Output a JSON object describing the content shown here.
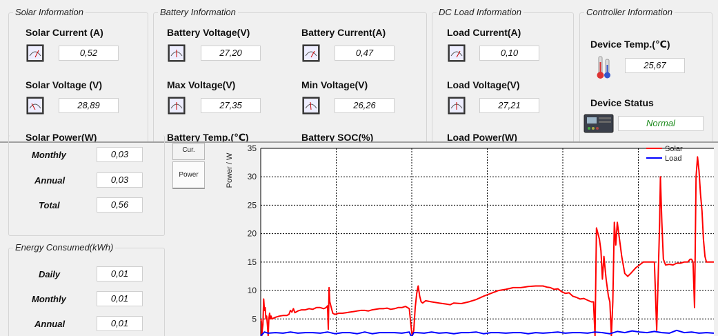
{
  "solar": {
    "title": "Solar Information",
    "current_label": "Solar Current (A)",
    "current_value": "0,52",
    "voltage_label": "Solar Voltage (V)",
    "voltage_value": "28,89",
    "power_label": "Solar Power(W)"
  },
  "battery": {
    "title": "Battery Information",
    "voltage_label": "Battery Voltage(V)",
    "voltage_value": "27,20",
    "current_label": "Battery Current(A)",
    "current_value": "0,47",
    "max_label": "Max Voltage(V)",
    "max_value": "27,35",
    "min_label": "Min Voltage(V)",
    "min_value": "26,26",
    "temp_label": "Battery Temp.(℃)",
    "soc_label": "Battery SOC(%)"
  },
  "load": {
    "title": "DC Load Information",
    "current_label": "Load Current(A)",
    "current_value": "0,10",
    "voltage_label": "Load Voltage(V)",
    "voltage_value": "27,21",
    "power_label": "Load Power(W)"
  },
  "controller": {
    "title": "Controller Information",
    "temp_label": "Device Temp.(℃)",
    "temp_value": "25,67",
    "status_label": "Device Status",
    "status_value": "Normal"
  },
  "generated": {
    "monthly_label": "Monthly",
    "monthly_value": "0,03",
    "annual_label": "Annual",
    "annual_value": "0,03",
    "total_label": "Total",
    "total_value": "0,56"
  },
  "consumed": {
    "title": "Energy Consumed(kWh)",
    "daily_label": "Daily",
    "daily_value": "0,01",
    "monthly_label": "Monthly",
    "monthly_value": "0,01",
    "annual_label": "Annual",
    "annual_value": "0,01"
  },
  "tabs": {
    "current": "Cur.",
    "power": "Power"
  },
  "icons": {
    "meter": "analog-meter-icon",
    "thermometer": "thermometer-icon",
    "controller": "charge-controller-icon"
  },
  "chart_data": {
    "type": "line",
    "ylabel": "Power / W",
    "ylim": [
      2,
      35
    ],
    "yticks": [
      5,
      10,
      15,
      20,
      25,
      30,
      35
    ],
    "grid": true,
    "legend_position": "top-right",
    "colors": {
      "Solar": "#ff0000",
      "Load": "#0000ff"
    },
    "series": [
      {
        "name": "Solar",
        "points": [
          [
            0,
            5
          ],
          [
            1,
            4.5
          ],
          [
            1.5,
            2
          ],
          [
            2,
            3
          ],
          [
            3,
            4
          ],
          [
            4,
            8.5
          ],
          [
            5,
            6.5
          ],
          [
            6,
            7
          ],
          [
            7,
            5
          ],
          [
            8,
            5.5
          ],
          [
            9,
            4
          ],
          [
            10,
            2
          ],
          [
            11,
            5
          ],
          [
            12,
            6
          ],
          [
            13,
            5
          ],
          [
            14,
            5.5
          ],
          [
            15,
            5
          ],
          [
            20,
            5.3
          ],
          [
            25,
            5.5
          ],
          [
            30,
            5.6
          ],
          [
            35,
            5.6
          ],
          [
            38,
            5.8
          ],
          [
            40,
            6.5
          ],
          [
            42,
            6.2
          ],
          [
            44,
            6.8
          ],
          [
            46,
            6.1
          ],
          [
            50,
            6.4
          ],
          [
            55,
            6.6
          ],
          [
            60,
            6.6
          ],
          [
            65,
            6.8
          ],
          [
            70,
            6.7
          ],
          [
            75,
            7
          ],
          [
            80,
            7
          ],
          [
            85,
            6.8
          ],
          [
            88,
            7
          ],
          [
            90,
            7.3
          ],
          [
            91,
            3.2
          ],
          [
            92,
            10.5
          ],
          [
            93,
            8
          ],
          [
            95,
            7
          ],
          [
            97,
            6
          ],
          [
            100,
            5.8
          ],
          [
            105,
            6
          ],
          [
            110,
            6
          ],
          [
            115,
            6.1
          ],
          [
            120,
            6.2
          ],
          [
            125,
            6.3
          ],
          [
            130,
            6.4
          ],
          [
            135,
            6.5
          ],
          [
            140,
            6.5
          ],
          [
            145,
            6.4
          ],
          [
            150,
            6.6
          ],
          [
            155,
            6.7
          ],
          [
            160,
            6.8
          ],
          [
            165,
            6.8
          ],
          [
            170,
            6.9
          ],
          [
            175,
            6.7
          ],
          [
            180,
            6.8
          ],
          [
            185,
            7
          ],
          [
            190,
            7
          ],
          [
            195,
            7.2
          ],
          [
            200,
            6.8
          ],
          [
            203,
            3
          ],
          [
            204,
            2
          ],
          [
            206,
            3
          ],
          [
            208,
            7
          ],
          [
            210,
            9.5
          ],
          [
            212,
            10.8
          ],
          [
            214,
            9
          ],
          [
            216,
            8
          ],
          [
            218,
            7.8
          ],
          [
            222,
            8.2
          ],
          [
            230,
            8
          ],
          [
            240,
            7.8
          ],
          [
            250,
            7.6
          ],
          [
            255,
            7.5
          ],
          [
            260,
            7.8
          ],
          [
            270,
            7.7
          ],
          [
            280,
            8
          ],
          [
            290,
            8.4
          ],
          [
            300,
            9
          ],
          [
            310,
            9.5
          ],
          [
            320,
            10
          ],
          [
            330,
            10.2
          ],
          [
            340,
            10.5
          ],
          [
            350,
            10.5
          ],
          [
            360,
            10.7
          ],
          [
            370,
            10.8
          ],
          [
            380,
            10.8
          ],
          [
            385,
            10.6
          ],
          [
            390,
            10.5
          ],
          [
            395,
            10.2
          ],
          [
            400,
            10.3
          ],
          [
            405,
            9.8
          ],
          [
            410,
            9.5
          ],
          [
            415,
            9.6
          ],
          [
            420,
            9
          ],
          [
            425,
            8.8
          ],
          [
            430,
            8.5
          ],
          [
            435,
            8.6
          ],
          [
            440,
            8.3
          ],
          [
            445,
            8
          ],
          [
            448,
            8
          ],
          [
            450,
            2
          ],
          [
            452,
            21
          ],
          [
            454,
            20
          ],
          [
            456,
            19
          ],
          [
            458,
            17
          ],
          [
            460,
            12
          ],
          [
            462,
            16
          ],
          [
            465,
            12
          ],
          [
            468,
            9
          ],
          [
            470,
            8
          ],
          [
            472,
            2
          ],
          [
            474,
            8
          ],
          [
            476,
            22
          ],
          [
            478,
            18
          ],
          [
            480,
            22
          ],
          [
            482,
            20
          ],
          [
            484,
            18
          ],
          [
            486,
            16
          ],
          [
            490,
            13
          ],
          [
            494,
            12.5
          ],
          [
            498,
            13
          ],
          [
            505,
            14
          ],
          [
            510,
            14.5
          ],
          [
            515,
            15
          ],
          [
            520,
            15
          ],
          [
            525,
            15
          ],
          [
            530,
            15
          ],
          [
            531,
            11
          ],
          [
            533,
            3
          ],
          [
            535,
            12
          ],
          [
            537,
            22
          ],
          [
            538,
            30
          ],
          [
            540,
            22
          ],
          [
            542,
            15.5
          ],
          [
            545,
            14.5
          ],
          [
            550,
            14.6
          ],
          [
            555,
            14.5
          ],
          [
            560,
            14.8
          ],
          [
            565,
            14.8
          ],
          [
            570,
            15
          ],
          [
            575,
            15
          ],
          [
            578,
            15.5
          ],
          [
            580,
            15.5
          ],
          [
            582,
            15
          ],
          [
            584,
            7
          ],
          [
            586,
            30
          ],
          [
            588,
            33.5
          ],
          [
            590,
            31
          ],
          [
            592,
            27
          ],
          [
            594,
            24
          ],
          [
            596,
            19
          ],
          [
            598,
            16
          ],
          [
            600,
            15
          ],
          [
            605,
            15
          ],
          [
            610,
            15
          ]
        ]
      },
      {
        "name": "Load",
        "points": [
          [
            0,
            2
          ],
          [
            5,
            2.7
          ],
          [
            10,
            2.5
          ],
          [
            20,
            2.6
          ],
          [
            30,
            2.5
          ],
          [
            40,
            2.7
          ],
          [
            50,
            2.5
          ],
          [
            60,
            2.6
          ],
          [
            70,
            2.6
          ],
          [
            80,
            2.5
          ],
          [
            90,
            2.7
          ],
          [
            100,
            2.4
          ],
          [
            110,
            2.6
          ],
          [
            120,
            2.6
          ],
          [
            130,
            2.4
          ],
          [
            140,
            2.7
          ],
          [
            150,
            2.4
          ],
          [
            160,
            2.6
          ],
          [
            170,
            2.6
          ],
          [
            180,
            2.6
          ],
          [
            190,
            2.5
          ],
          [
            200,
            2.7
          ],
          [
            203,
            1.8
          ],
          [
            206,
            2.6
          ],
          [
            210,
            2.6
          ],
          [
            220,
            2.5
          ],
          [
            230,
            2.7
          ],
          [
            240,
            2.5
          ],
          [
            250,
            2.6
          ],
          [
            260,
            2.4
          ],
          [
            270,
            2.6
          ],
          [
            280,
            2.6
          ],
          [
            290,
            2.7
          ],
          [
            300,
            2.4
          ],
          [
            310,
            2.6
          ],
          [
            320,
            2.6
          ],
          [
            330,
            2.5
          ],
          [
            340,
            2.6
          ],
          [
            350,
            2.6
          ],
          [
            360,
            2.4
          ],
          [
            370,
            2.6
          ],
          [
            380,
            2.5
          ],
          [
            390,
            2.6
          ],
          [
            400,
            2.7
          ],
          [
            410,
            2.5
          ],
          [
            420,
            2.6
          ],
          [
            430,
            2.6
          ],
          [
            440,
            2.5
          ],
          [
            450,
            2.7
          ],
          [
            460,
            2.6
          ],
          [
            470,
            2.4
          ],
          [
            480,
            2.8
          ],
          [
            490,
            2.6
          ],
          [
            500,
            2.9
          ],
          [
            510,
            2.7
          ],
          [
            520,
            2.6
          ],
          [
            530,
            2.8
          ],
          [
            540,
            2.6
          ],
          [
            550,
            2.5
          ],
          [
            560,
            3
          ],
          [
            570,
            2.6
          ],
          [
            580,
            2.7
          ],
          [
            590,
            2.5
          ],
          [
            600,
            2.6
          ],
          [
            610,
            2.5
          ]
        ]
      }
    ]
  }
}
